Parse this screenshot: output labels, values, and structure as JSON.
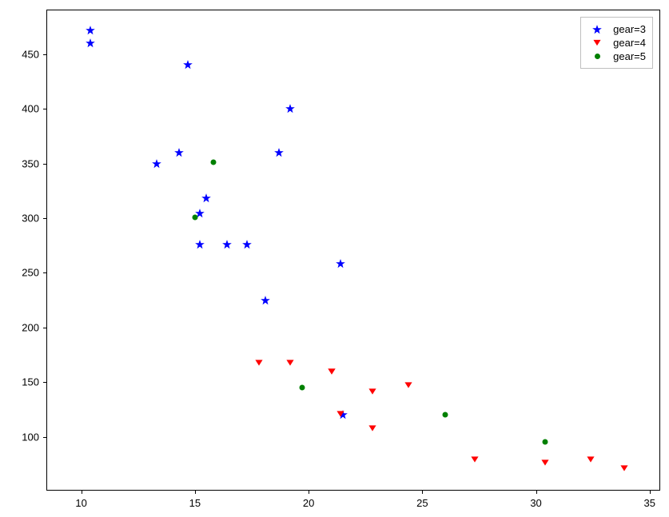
{
  "chart_data": {
    "type": "scatter",
    "title": "",
    "xlabel": "",
    "ylabel": "",
    "xlim": [
      8.5,
      35.5
    ],
    "ylim": [
      50,
      490
    ],
    "xticks": [
      10,
      15,
      20,
      25,
      30,
      35
    ],
    "yticks": [
      100,
      150,
      200,
      250,
      300,
      350,
      400,
      450
    ],
    "series": [
      {
        "name": "gear=3",
        "marker": "star",
        "color": "blue",
        "points": [
          {
            "x": 21.4,
            "y": 258
          },
          {
            "x": 18.7,
            "y": 360
          },
          {
            "x": 18.1,
            "y": 225
          },
          {
            "x": 14.3,
            "y": 360
          },
          {
            "x": 16.4,
            "y": 276
          },
          {
            "x": 17.3,
            "y": 276
          },
          {
            "x": 15.2,
            "y": 276
          },
          {
            "x": 10.4,
            "y": 472
          },
          {
            "x": 10.4,
            "y": 460
          },
          {
            "x": 14.7,
            "y": 440
          },
          {
            "x": 21.5,
            "y": 120
          },
          {
            "x": 15.5,
            "y": 318
          },
          {
            "x": 15.2,
            "y": 304
          },
          {
            "x": 13.3,
            "y": 350
          },
          {
            "x": 19.2,
            "y": 400
          }
        ]
      },
      {
        "name": "gear=4",
        "marker": "triangle_down",
        "color": "red",
        "points": [
          {
            "x": 21.0,
            "y": 160
          },
          {
            "x": 21.0,
            "y": 160
          },
          {
            "x": 22.8,
            "y": 108
          },
          {
            "x": 24.4,
            "y": 147
          },
          {
            "x": 22.8,
            "y": 141
          },
          {
            "x": 19.2,
            "y": 168
          },
          {
            "x": 17.8,
            "y": 168
          },
          {
            "x": 32.4,
            "y": 79
          },
          {
            "x": 30.4,
            "y": 76
          },
          {
            "x": 33.9,
            "y": 71
          },
          {
            "x": 27.3,
            "y": 79
          },
          {
            "x": 21.4,
            "y": 121
          }
        ]
      },
      {
        "name": "gear=5",
        "marker": "dot",
        "color": "green",
        "points": [
          {
            "x": 26.0,
            "y": 120
          },
          {
            "x": 30.4,
            "y": 95
          },
          {
            "x": 15.8,
            "y": 351
          },
          {
            "x": 19.7,
            "y": 145
          },
          {
            "x": 15.0,
            "y": 301
          }
        ]
      }
    ],
    "legend": {
      "position": "upper-right",
      "entries": [
        "gear=3",
        "gear=4",
        "gear=5"
      ]
    }
  }
}
